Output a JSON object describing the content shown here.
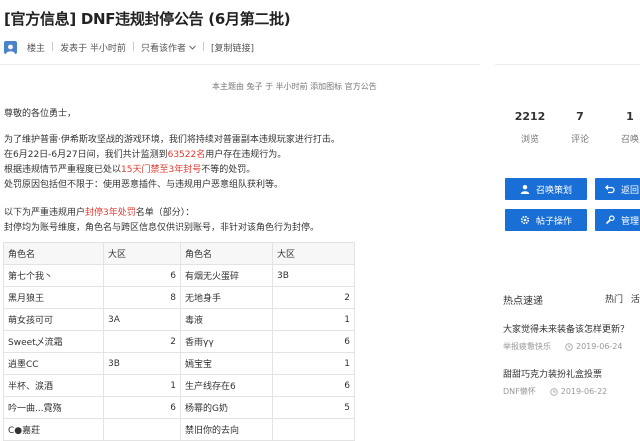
{
  "post": {
    "title": "[官方信息] DNF违规封停公告 (6月第二批)",
    "author": "楼主",
    "posted": "发表于 半小时前",
    "view_author_only": "只看该作者",
    "copy_link": "[复制链接]",
    "author_line": "本主题由 兔子 于 半小时前 添加图标 官方公告"
  },
  "content": {
    "greeting": "尊敬的各位勇士，",
    "p1": "为了维护普雷·伊希斯攻坚战的游戏环境，我们将持续对普雷副本违规玩家进行打击。",
    "p2_a": "在6月22日-6月27日间，我们共计监测到",
    "p2_red": "63522名",
    "p2_b": "用户存在违规行为。",
    "p3_a": "根据违规情节严重程度已处以",
    "p3_red": "15天门禁至3年封号",
    "p3_b": "不等的处罚。",
    "p4": "处罚原因包括但不限于：使用恶意插件、与违规用户恶意组队获利等。",
    "p5_a": "以下为严重违规用户",
    "p5_red": "封停3年处罚",
    "p5_b": "名单（部分）：",
    "p6": "封停均为账号维度，角色名与跨区信息仅供识别账号，非针对该角色行为封停。"
  },
  "table": {
    "headers": [
      "角色名",
      "大区",
      "角色名",
      "大区"
    ],
    "rows": [
      [
        "第七个我丶",
        "6",
        "有烟无火蛋碎",
        "3B"
      ],
      [
        "黑月狼王",
        "8",
        "无地身手",
        "2"
      ],
      [
        "萌女孩可可",
        "3A",
        "毒液",
        "1"
      ],
      [
        "Sweet乄流霜",
        "2",
        "香雨γγ",
        "6"
      ],
      [
        "逍墨CC",
        "3B",
        "嫣宝宝",
        "1"
      ],
      [
        "半杯、涙酒",
        "1",
        "生产线存在6",
        "6"
      ],
      [
        "吟一曲...霓殇",
        "6",
        "杨幂的G奶",
        "5"
      ],
      [
        "C●嘉莊",
        "",
        "禁旧你的去向",
        ""
      ]
    ]
  },
  "stats": [
    {
      "value": "2212",
      "label": "浏览"
    },
    {
      "value": "7",
      "label": "评论"
    },
    {
      "value": "1",
      "label": "召唤"
    }
  ],
  "buttons": {
    "summon": "召唤策划",
    "back": "返回",
    "post_ops": "帖子操作",
    "manage": "管理"
  },
  "hot": {
    "title": "热点速递",
    "tab": "热门",
    "tab2": "活",
    "items": [
      {
        "title": "大家觉得未来装备该怎样更新？",
        "source": "举报疲惫快乐",
        "date": "2019-06-24"
      },
      {
        "title": "甜甜巧克力装扮礼盒投票",
        "source": "DNF懒怀",
        "date": "2019-06-22"
      }
    ]
  },
  "colors": {
    "accent": "#1a6fd6",
    "highlight": "#e23a2e"
  }
}
